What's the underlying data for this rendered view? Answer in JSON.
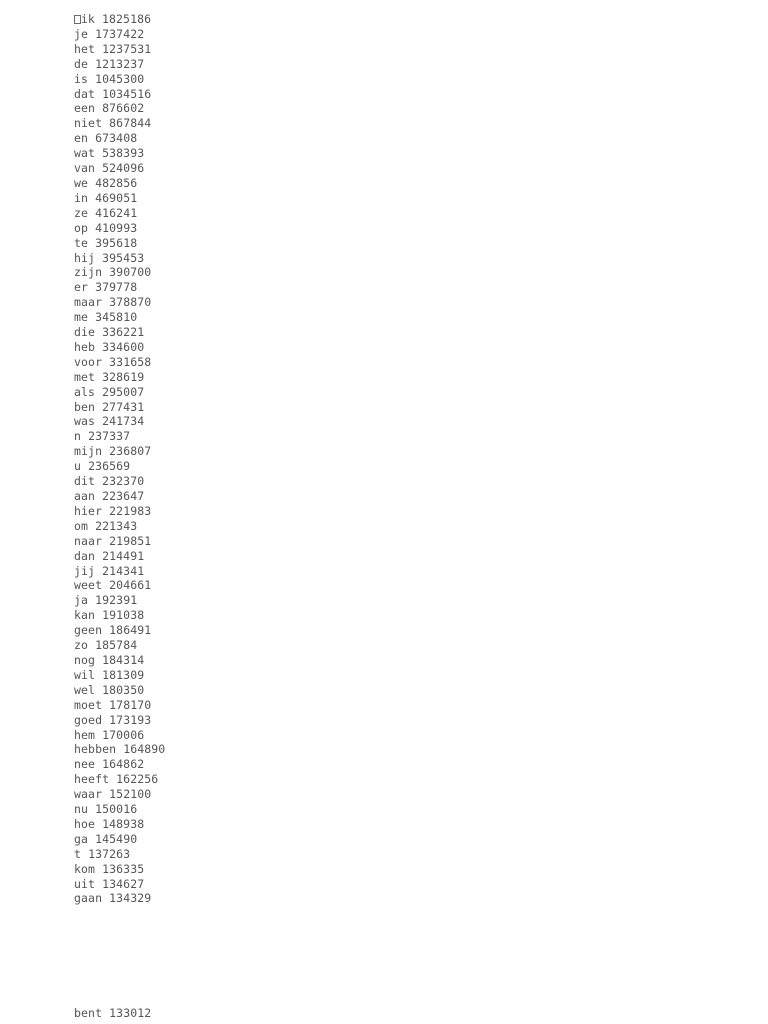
{
  "document": {
    "type": "plain-text-word-frequency-list",
    "language": "Dutch",
    "background_color": "#ffffff",
    "text_color": "#555555",
    "leading_glyph": {
      "name": "missing-glyph-box",
      "description": "tofu box rendered for an unmapped/invisible character preceding the first word"
    }
  },
  "blocks": [
    {
      "id": "primary",
      "lines": [
        {
          "word": "ik",
          "count": "1825186",
          "has_leading_glyph": true
        },
        {
          "word": "je",
          "count": "1737422"
        },
        {
          "word": "het",
          "count": "1237531"
        },
        {
          "word": "de",
          "count": "1213237"
        },
        {
          "word": "is",
          "count": "1045300"
        },
        {
          "word": "dat",
          "count": "1034516"
        },
        {
          "word": "een",
          "count": "876602"
        },
        {
          "word": "niet",
          "count": "867844"
        },
        {
          "word": "en",
          "count": "673408"
        },
        {
          "word": "wat",
          "count": "538393"
        },
        {
          "word": "van",
          "count": "524096"
        },
        {
          "word": "we",
          "count": "482856"
        },
        {
          "word": "in",
          "count": "469051"
        },
        {
          "word": "ze",
          "count": "416241"
        },
        {
          "word": "op",
          "count": "410993"
        },
        {
          "word": "te",
          "count": "395618"
        },
        {
          "word": "hij",
          "count": "395453"
        },
        {
          "word": "zijn",
          "count": "390700"
        },
        {
          "word": "er",
          "count": "379778"
        },
        {
          "word": "maar",
          "count": "378870"
        },
        {
          "word": "me",
          "count": "345810"
        },
        {
          "word": "die",
          "count": "336221"
        },
        {
          "word": "heb",
          "count": "334600"
        },
        {
          "word": "voor",
          "count": "331658"
        },
        {
          "word": "met",
          "count": "328619"
        },
        {
          "word": "als",
          "count": "295007"
        },
        {
          "word": "ben",
          "count": "277431"
        },
        {
          "word": "was",
          "count": "241734"
        },
        {
          "word": "n",
          "count": "237337"
        },
        {
          "word": "mijn",
          "count": "236807"
        },
        {
          "word": "u",
          "count": "236569"
        },
        {
          "word": "dit",
          "count": "232370"
        },
        {
          "word": "aan",
          "count": "223647"
        },
        {
          "word": "hier",
          "count": "221983"
        },
        {
          "word": "om",
          "count": "221343"
        },
        {
          "word": "naar",
          "count": "219851"
        },
        {
          "word": "dan",
          "count": "214491"
        },
        {
          "word": "jij",
          "count": "214341"
        },
        {
          "word": "weet",
          "count": "204661"
        },
        {
          "word": "ja",
          "count": "192391"
        },
        {
          "word": "kan",
          "count": "191038"
        },
        {
          "word": "geen",
          "count": "186491"
        },
        {
          "word": "zo",
          "count": "185784"
        },
        {
          "word": "nog",
          "count": "184314"
        },
        {
          "word": "wil",
          "count": "181309"
        },
        {
          "word": "wel",
          "count": "180350"
        },
        {
          "word": "moet",
          "count": "178170"
        },
        {
          "word": "goed",
          "count": "173193"
        },
        {
          "word": "hem",
          "count": "170006"
        },
        {
          "word": "hebben",
          "count": "164890"
        },
        {
          "word": "nee",
          "count": "164862"
        },
        {
          "word": "heeft",
          "count": "162256"
        },
        {
          "word": "waar",
          "count": "152100"
        },
        {
          "word": "nu",
          "count": "150016"
        },
        {
          "word": "hoe",
          "count": "148938"
        },
        {
          "word": "ga",
          "count": "145490"
        },
        {
          "word": "t",
          "count": "137263"
        },
        {
          "word": "kom",
          "count": "136335"
        },
        {
          "word": "uit",
          "count": "134627"
        },
        {
          "word": "gaan",
          "count": "134329"
        }
      ]
    },
    {
      "id": "secondary",
      "lines": [
        {
          "word": "bent",
          "count": "133012"
        }
      ]
    }
  ]
}
